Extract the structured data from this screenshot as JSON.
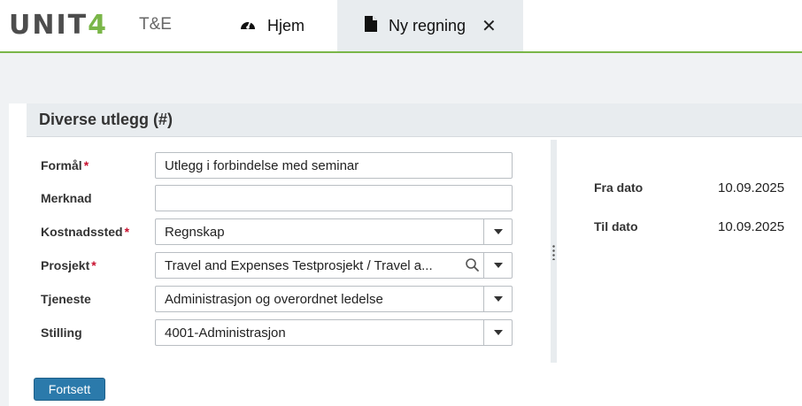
{
  "header": {
    "logo_text": "UNIT",
    "logo_accent": "4",
    "app_name": "T&E",
    "tabs": [
      {
        "label": "Hjem",
        "icon": "dashboard-gauge-icon"
      },
      {
        "label": "Ny regning",
        "icon": "document-icon",
        "active": true,
        "closable": true
      }
    ],
    "close_glyph": "✕"
  },
  "panel": {
    "title": "Diverse utlegg (#)"
  },
  "form": {
    "required_mark": "*",
    "fields": {
      "formal": {
        "label": "Formål",
        "required": true,
        "value": "Utlegg i forbindelse med seminar"
      },
      "merknad": {
        "label": "Merknad",
        "required": false,
        "value": ""
      },
      "kostnadssted": {
        "label": "Kostnadssted",
        "required": true,
        "value": "Regnskap"
      },
      "prosjekt": {
        "label": "Prosjekt",
        "required": true,
        "value": "Travel and Expenses Testprosjekt / Travel a..."
      },
      "tjeneste": {
        "label": "Tjeneste",
        "required": false,
        "value": "Administrasjon og overordnet ledelse"
      },
      "stilling": {
        "label": "Stilling",
        "required": false,
        "value": "4001-Administrasjon"
      }
    }
  },
  "dates": {
    "fra_label": "Fra dato",
    "fra_value": "10.09.2025",
    "til_label": "Til dato",
    "til_value": "10.09.2025"
  },
  "actions": {
    "continue_label": "Fortsett"
  },
  "colors": {
    "accent_green": "#7ab648",
    "button_blue": "#2b7aab",
    "required_red": "#c8102e"
  }
}
